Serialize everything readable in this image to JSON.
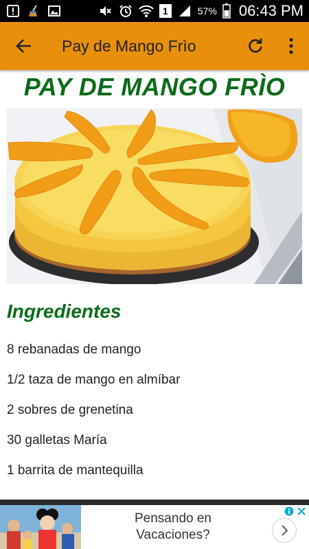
{
  "status_bar": {
    "battery_percent": "57%",
    "time": "06:43 PM",
    "sim_badge": "1",
    "icons": [
      "notification-alert-icon",
      "broom-icon",
      "image-icon",
      "mute-icon",
      "alarm-icon",
      "wifi-icon",
      "signal-icon",
      "battery-icon"
    ]
  },
  "appbar": {
    "title": "Pay de Mango Frìo",
    "color": "#e8900c",
    "icons": [
      "back-arrow-icon",
      "refresh-icon",
      "more-vert-icon"
    ]
  },
  "recipe": {
    "title": "PAY DE MANGO FRÌO",
    "title_color": "#0b6b1a",
    "image": "mango-cheesecake-photo",
    "ingredients_heading": "Ingredientes",
    "ingredients": [
      "8 rebanadas de mango",
      "1/2 taza de mango en almíbar",
      "2 sobres de grenetina",
      "30 galletas María",
      "1 barrita de mantequilla"
    ]
  },
  "ad": {
    "line1": "Pensando en",
    "line2": "Vacaciones?",
    "icons": [
      "ad-info-icon",
      "ad-close-icon",
      "chevron-right-icon"
    ]
  }
}
